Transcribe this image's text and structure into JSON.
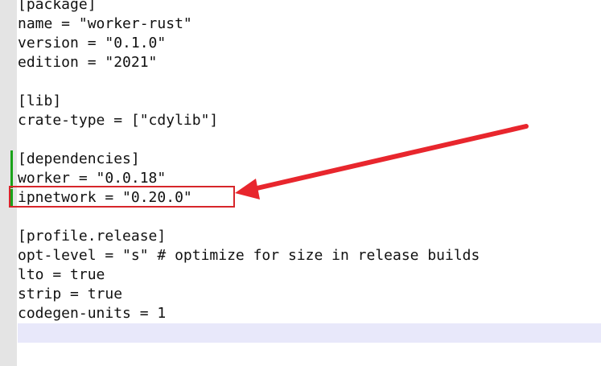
{
  "editor": {
    "lines": [
      "[package]",
      "name = \"worker-rust\"",
      "version = \"0.1.0\"",
      "edition = \"2021\"",
      "",
      "[lib]",
      "crate-type = [\"cdylib\"]",
      "",
      "[dependencies]",
      "worker = \"0.0.18\"",
      "ipnetwork = \"0.20.0\"",
      "",
      "[profile.release]",
      "opt-level = \"s\" # optimize for size in release builds",
      "lto = true",
      "strip = true",
      "codegen-units = 1"
    ],
    "current_line_color": "#e8e8fa",
    "gutter_color": "#e4e4e4",
    "change_marker_color": "#1aa31a"
  },
  "annotation": {
    "highlighted_line": "ipnetwork = \"0.20.0\"",
    "color": "#d7262b"
  }
}
